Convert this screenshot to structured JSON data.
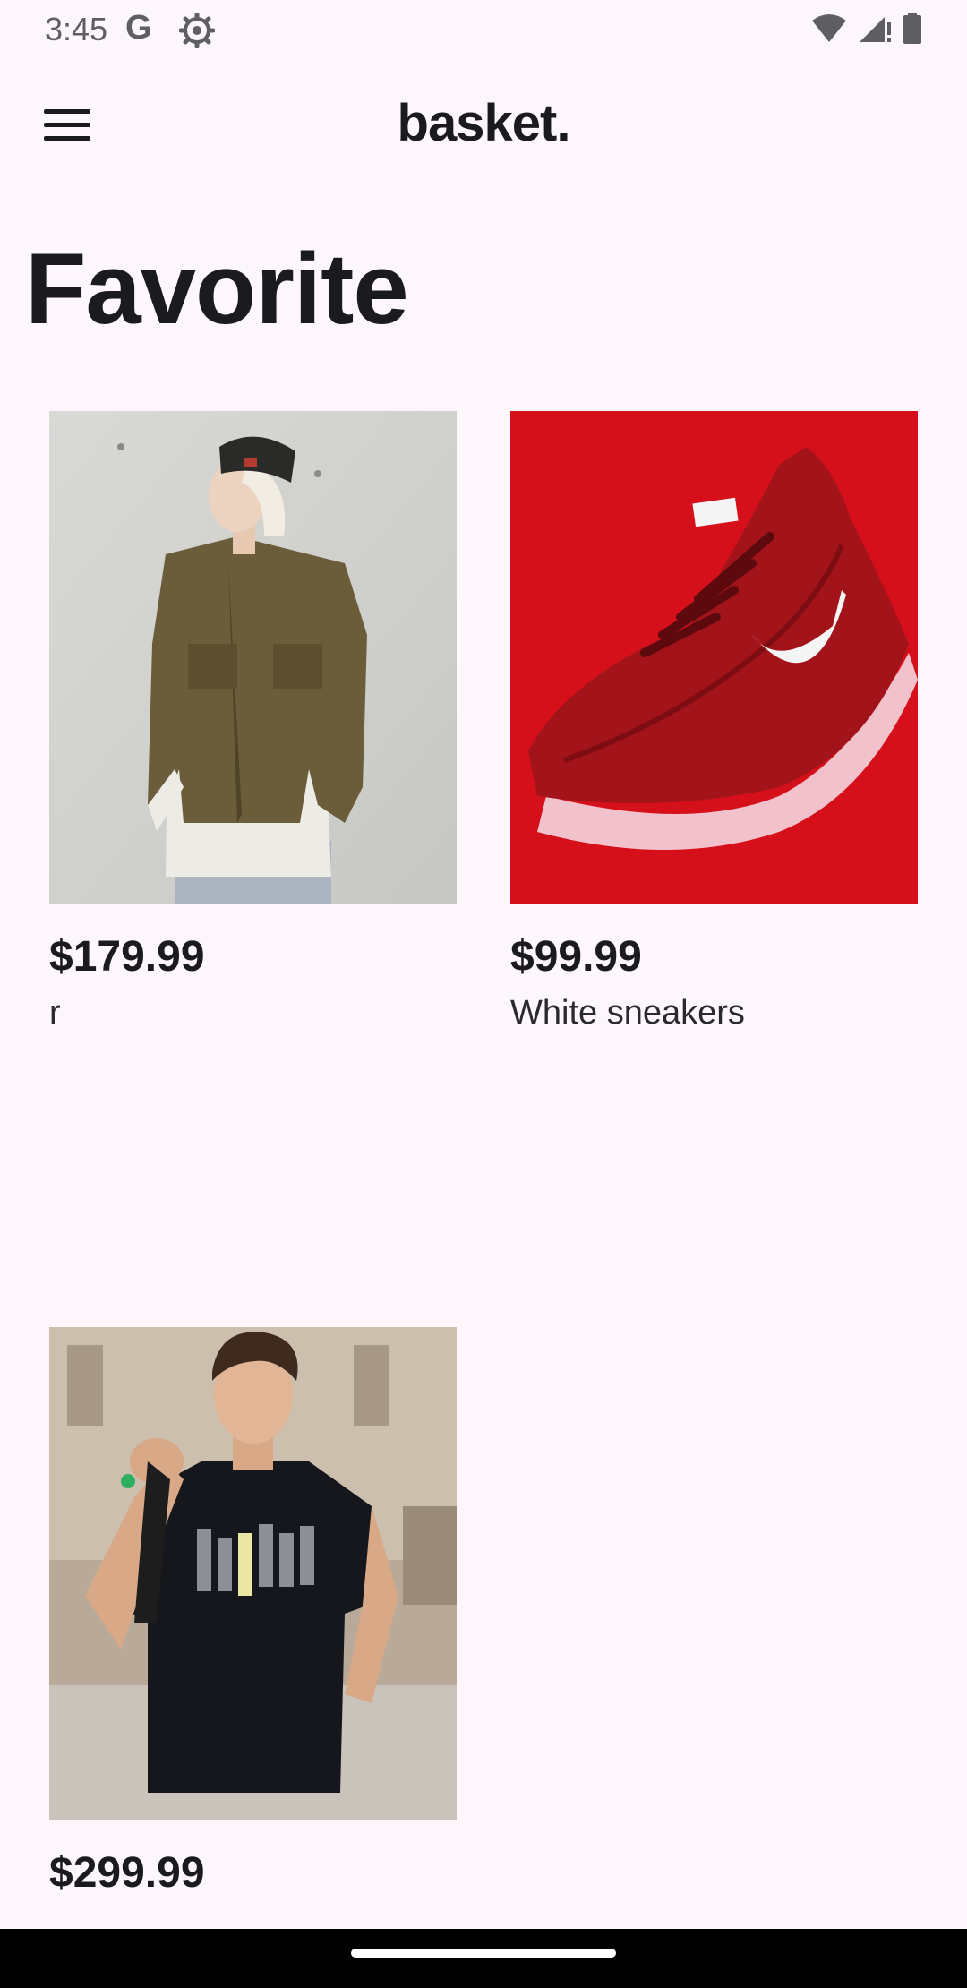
{
  "status_bar": {
    "time": "3:45",
    "g_label": "G",
    "icons": [
      "gear-icon",
      "wifi-icon",
      "signal-icon",
      "battery-icon"
    ]
  },
  "app_bar": {
    "title": "basket.",
    "menu_icon": "hamburger-menu-icon"
  },
  "page": {
    "title": "Favorite"
  },
  "products": [
    {
      "price": "$179.99",
      "name": "r",
      "image": "woman-olive-jacket-photo"
    },
    {
      "price": "$99.99",
      "name": "White sneakers",
      "image": "red-sneaker-photo"
    },
    {
      "price": "$299.99",
      "name": "",
      "image": "man-black-tshirt-photo"
    }
  ],
  "colors": {
    "background": "#fdf7fc",
    "text": "#1b1b1f",
    "nav_bar": "#000000"
  }
}
